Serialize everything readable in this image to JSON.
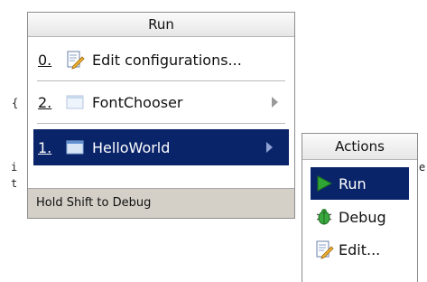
{
  "editor": {
    "brace": "{",
    "line1": "i",
    "line2": "t",
    "trail": "e"
  },
  "run_menu": {
    "title": "Run",
    "items": [
      {
        "mnemonic": "0.",
        "label": "Edit configurations...",
        "icon": "edit-config-icon",
        "has_submenu": false
      },
      {
        "mnemonic": "2.",
        "label": "FontChooser",
        "icon": "run-config-window-icon",
        "has_submenu": true
      },
      {
        "mnemonic": "1.",
        "label": "HelloWorld",
        "icon": "run-config-window-icon",
        "has_submenu": true,
        "selected": true
      }
    ],
    "hint": "Hold Shift to Debug"
  },
  "actions_menu": {
    "title": "Actions",
    "items": [
      {
        "label": "Run",
        "icon": "run-play-icon",
        "selected": true
      },
      {
        "label": "Debug",
        "icon": "debug-bug-icon"
      },
      {
        "label": "Edit...",
        "icon": "edit-config-icon"
      }
    ]
  },
  "colors": {
    "selection": "#0a246a",
    "hint_bar": "#d4d0c8",
    "run_green": "#2fa535"
  }
}
